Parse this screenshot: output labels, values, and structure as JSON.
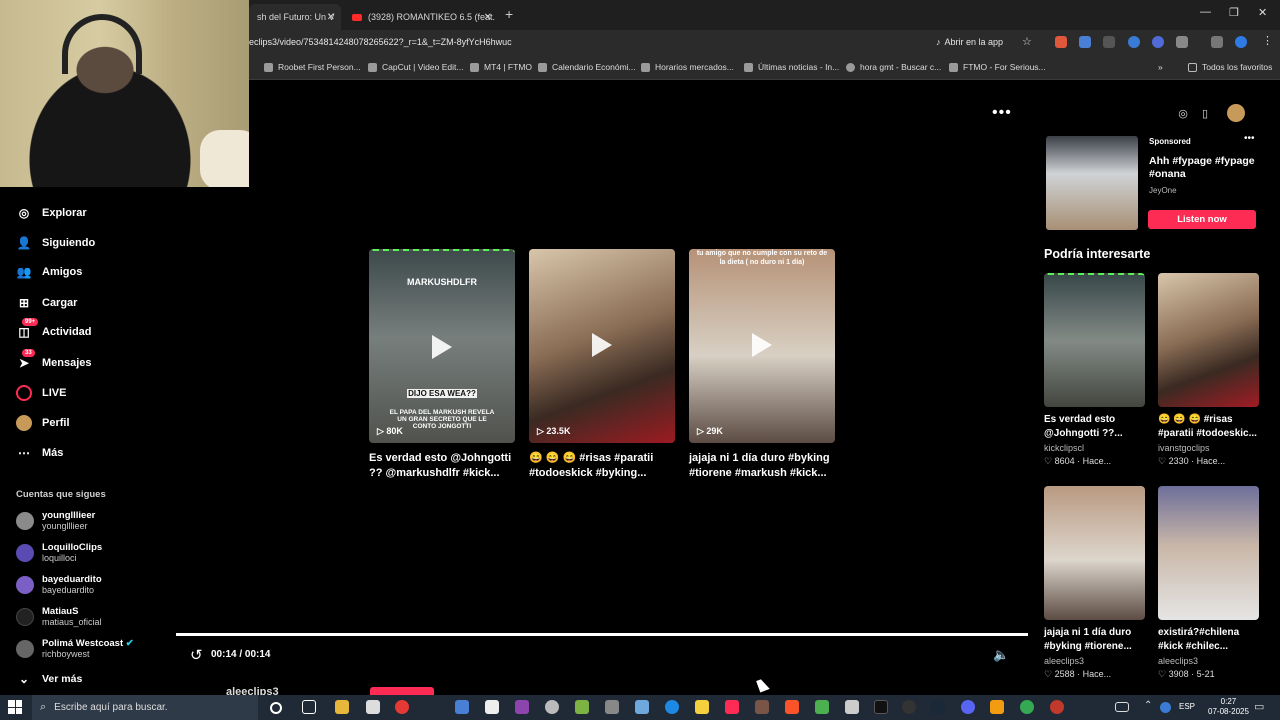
{
  "browser": {
    "tabs": [
      {
        "label": "sh del Futuro: Un V"
      },
      {
        "label": "(3928) ROMANTIKEO 6.5 (feat."
      }
    ],
    "url": "eclips3/video/7534814248078265622?_r=1&_t=ZM-8yfYcH6hwuc",
    "open_app_label": "Abrir en la app",
    "bookmarks": [
      "Roobet First Person...",
      "CapCut | Video Edit...",
      "MT4 | FTMO",
      "Calendario Económi...",
      "Horarios mercados...",
      "Últimas noticias - In...",
      "hora gmt - Buscar c...",
      "FTMO - For Serious..."
    ],
    "all_favorites_label": "Todos los favoritos"
  },
  "sidebar": {
    "nav": [
      {
        "label": "Explorar",
        "icon": "compass-icon"
      },
      {
        "label": "Siguiendo",
        "icon": "following-icon"
      },
      {
        "label": "Amigos",
        "icon": "friends-icon"
      },
      {
        "label": "Cargar",
        "icon": "upload-icon"
      },
      {
        "label": "Actividad",
        "icon": "activity-icon",
        "badge": "99+"
      },
      {
        "label": "Mensajes",
        "icon": "messages-icon",
        "badge": "33"
      },
      {
        "label": "LIVE",
        "icon": "live-icon"
      },
      {
        "label": "Perfil",
        "icon": "profile-icon"
      },
      {
        "label": "Más",
        "icon": "more-icon"
      }
    ],
    "following_title": "Cuentas que sigues",
    "accounts": [
      {
        "name": "younglllieer",
        "user": "younglllieer",
        "color": "#8a8a8a"
      },
      {
        "name": "LoquilloClips",
        "user": "loquilloci",
        "color": "#5a4bb3"
      },
      {
        "name": "bayeduardito",
        "user": "bayeduardito",
        "color": "#7b5fc4"
      },
      {
        "name": "MatiauS",
        "user": "matiaus_oficial",
        "color": "#222222"
      },
      {
        "name": "Polimá Westcoast",
        "user": "richboywest",
        "color": "#666666"
      }
    ],
    "see_more": "Ver más"
  },
  "feed": {
    "videos": [
      {
        "overlay_top": "MARKUSHDLFR",
        "overlay_mid": "DIJO ESA WEA??",
        "overlay_bottom": "EL PAPA DEL MARKUSH REVELA UN GRAN SECRETO QUE LE CONTO JONGOTTI",
        "views": "80K",
        "caption": "Es verdad esto @Johngotti ?? @markushdlfr #kick..."
      },
      {
        "overlay_top": "",
        "overlay_mid": "",
        "overlay_bottom": "",
        "views": "23.5K",
        "caption": "😄 😄 😄 #risas #paratii #todoeskick #byking..."
      },
      {
        "overlay_top": "tu amigo que no cumple con su reto de la dieta ( no duro ni 1 día)",
        "overlay_mid": "",
        "overlay_bottom": "",
        "views": "29K",
        "caption": "jajaja ni 1 día duro #byking #tiorene #markush #kick..."
      }
    ],
    "progress": 1.0,
    "time": "00:14 / 00:14",
    "author": "aleeclips3"
  },
  "sponsored": {
    "label": "Sponsored",
    "title": "Ahh #fypage #fypage #onana",
    "author": "JeyOne",
    "button": "Listen now"
  },
  "recommended": {
    "title": "Podría interesarte",
    "items": [
      {
        "caption": "Es verdad esto @Johngotti ??...",
        "author": "kickclipscl",
        "likes": "8604",
        "date": "Hace..."
      },
      {
        "caption": "😄 😄 😄 #risas #paratii #todoeskic...",
        "author": "ivanstgoclips",
        "likes": "2330",
        "date": "Hace..."
      },
      {
        "caption": "jajaja ni 1 día duro #byking #tiorene...",
        "author": "aleeclips3",
        "likes": "2588",
        "date": "Hace..."
      },
      {
        "caption": "existirá?#chilena #kick #chilec...",
        "author": "aleeclips3",
        "likes": "3908",
        "date": "5-21"
      }
    ]
  },
  "taskbar": {
    "search_placeholder": "Escribe aquí para buscar.",
    "lang": "ESP",
    "time": "0:27",
    "date": "07-08-2025"
  }
}
